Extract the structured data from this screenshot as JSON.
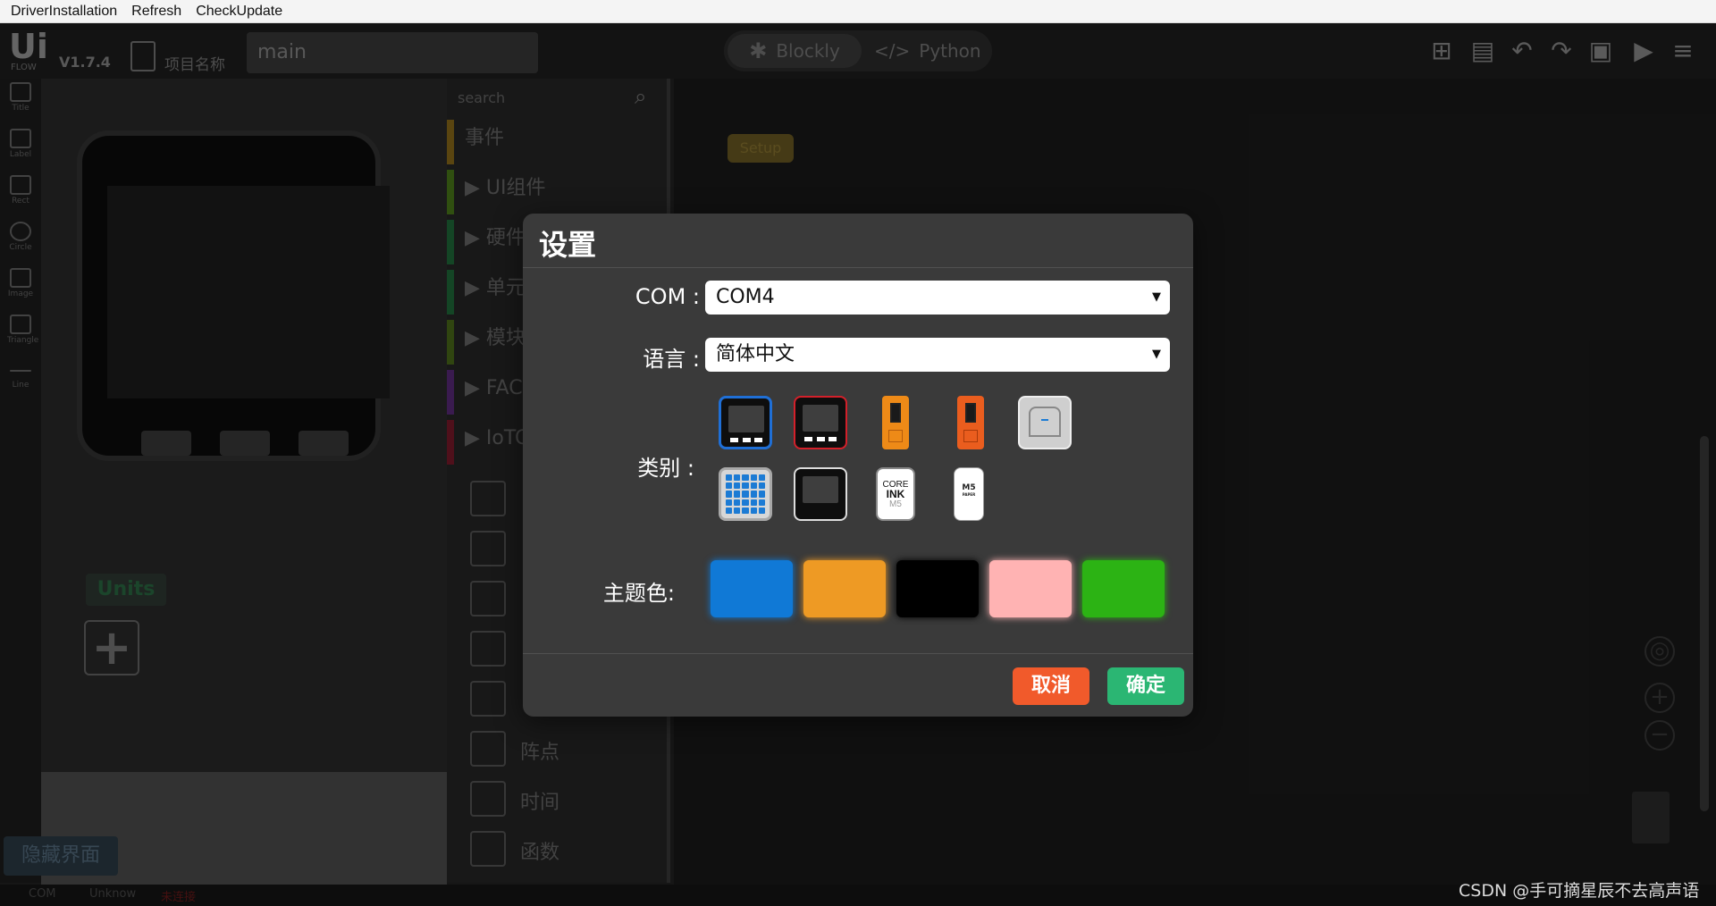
{
  "menubar": {
    "items": [
      "DriverInstallation",
      "Refresh",
      "CheckUpdate"
    ]
  },
  "app": {
    "logo": "Ui",
    "logo_sub": "FLOW",
    "version": "V1.7.4",
    "project_label": "项目名称",
    "project_name": "main",
    "mode_blockly": "Blockly",
    "mode_python": "Python"
  },
  "left_tools": [
    "Title",
    "Label",
    "Rect",
    "Circle",
    "Image",
    "Triangle",
    "Line"
  ],
  "design": {
    "units_label": "Units",
    "hide_ui": "隐藏界面"
  },
  "palette": {
    "search_placeholder": "search",
    "categories": [
      {
        "label": "事件",
        "color": "#8a6a1a"
      },
      {
        "label": "▶ UI组件",
        "color": "#4a7a1a"
      },
      {
        "label": "▶ 硬件",
        "color": "#1f6a3a"
      },
      {
        "label": "▶ 单元",
        "color": "#1f6a3a"
      },
      {
        "label": "▶ 模块",
        "color": "#4a6a1a"
      },
      {
        "label": "▶ FACE",
        "color": "#5a2a7a"
      },
      {
        "label": "▶ IoTC",
        "color": "#7a1a2a"
      }
    ],
    "items": [
      "阵点",
      "时间",
      "函数"
    ]
  },
  "workspace": {
    "setup_block": "Setup"
  },
  "status": {
    "com": "COM",
    "state": "Unknow",
    "badge": "未连接"
  },
  "dialog": {
    "title": "设置",
    "com_label": "COM :",
    "com_value": "COM4",
    "language_label": "语言 :",
    "language_value": "简体中文",
    "category_label": "类别 :",
    "theme_label": "主题色:",
    "device_labels": {
      "core_ink": [
        "CORE",
        "INK",
        "M5"
      ],
      "paper": [
        "M5",
        "PAPER"
      ]
    },
    "theme_colors": [
      "#1079d6",
      "#ee9a24",
      "#000000",
      "#ffb3b3",
      "#2cb314"
    ],
    "cancel": "取消",
    "ok": "确定",
    "cancel_color": "#f15a2b",
    "ok_color": "#2bb673"
  },
  "watermark": "CSDN @手可摘星辰不去高声语"
}
